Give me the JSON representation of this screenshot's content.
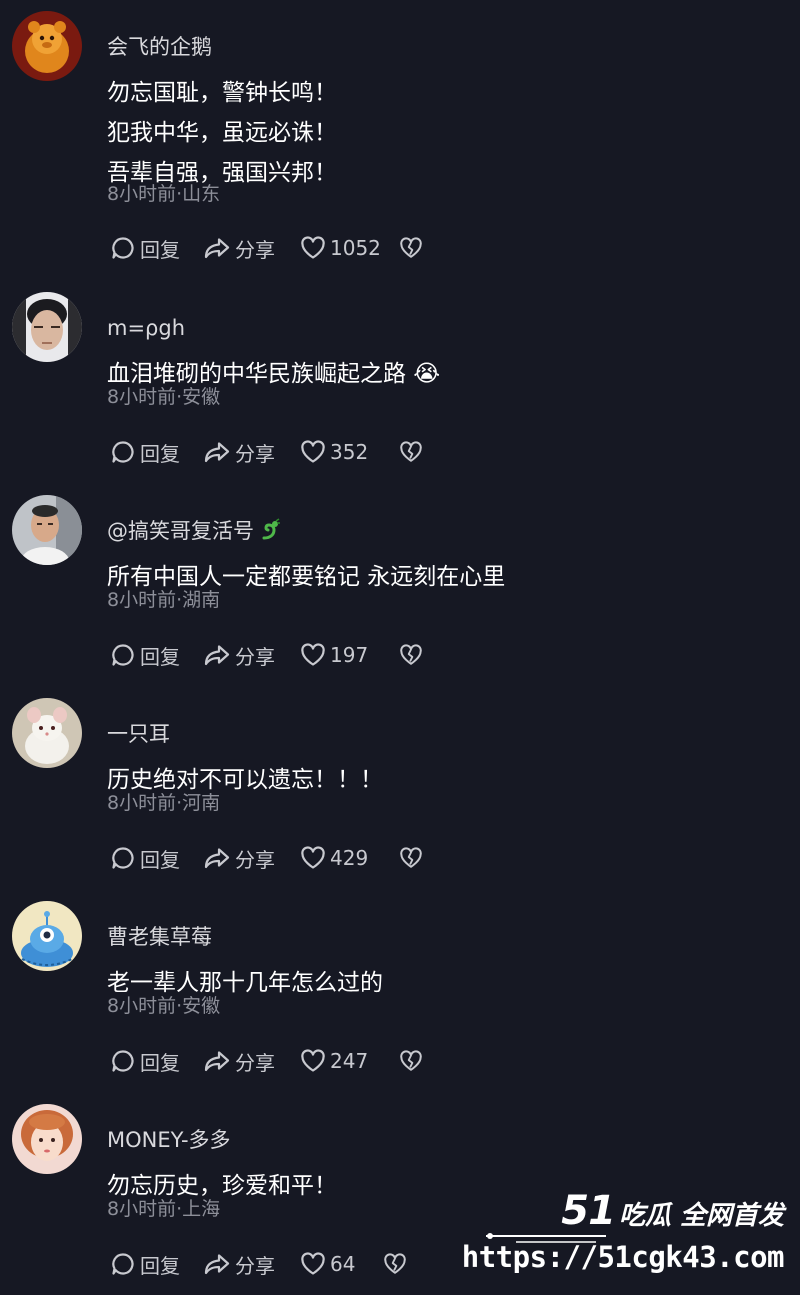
{
  "colors": {
    "background": "#161823",
    "text": "#ffffff",
    "username": "#d9d9dd",
    "meta": "#8d8f99",
    "actions": "#c8c9cf"
  },
  "actions": {
    "reply_label": "回复",
    "share_label": "分享",
    "reply_icon": "comment-bubble-icon",
    "share_icon": "share-arrow-icon",
    "like_icon": "heart-outline-icon",
    "dislike_icon": "broken-heart-icon"
  },
  "comments": [
    {
      "username": "会飞的企鹅",
      "avatar": "orange-plush-avatar",
      "lines": [
        "勿忘国耻，警钟长鸣！",
        "犯我中华，虽远必诛！",
        "吾辈自强，强国兴邦！"
      ],
      "meta": "8小时前·山东",
      "likes": "1052"
    },
    {
      "username": "m=ρgh",
      "avatar": "young-man-portrait-avatar",
      "lines": [
        "血泪堆砌的中华民族崛起之路 😭"
      ],
      "meta": "8小时前·安徽",
      "likes": "352"
    },
    {
      "username": "@搞笑哥复活号",
      "avatar": "man-portrait-avatar",
      "badge": "dragon-emoji",
      "lines": [
        "所有中国人一定都要铭记 永远刻在心里"
      ],
      "meta": "8小时前·湖南",
      "likes": "197"
    },
    {
      "username": "一只耳",
      "avatar": "white-mouse-avatar",
      "lines": [
        "历史绝对不可以遗忘！！！"
      ],
      "meta": "8小时前·河南",
      "likes": "429"
    },
    {
      "username": "曹老集草莓",
      "avatar": "blue-cartoon-creature-avatar",
      "lines": [
        "老一辈人那十几年怎么过的"
      ],
      "meta": "8小时前·安徽",
      "likes": "247"
    },
    {
      "username": "MONEY-多多",
      "avatar": "woman-portrait-avatar",
      "lines": [
        "勿忘历史，珍爱和平！"
      ],
      "meta": "8小时前·上海",
      "likes": "64"
    }
  ],
  "watermark": {
    "number": "51",
    "tagline": "吃瓜 全网首发",
    "url": "https://51cgk43.com"
  }
}
